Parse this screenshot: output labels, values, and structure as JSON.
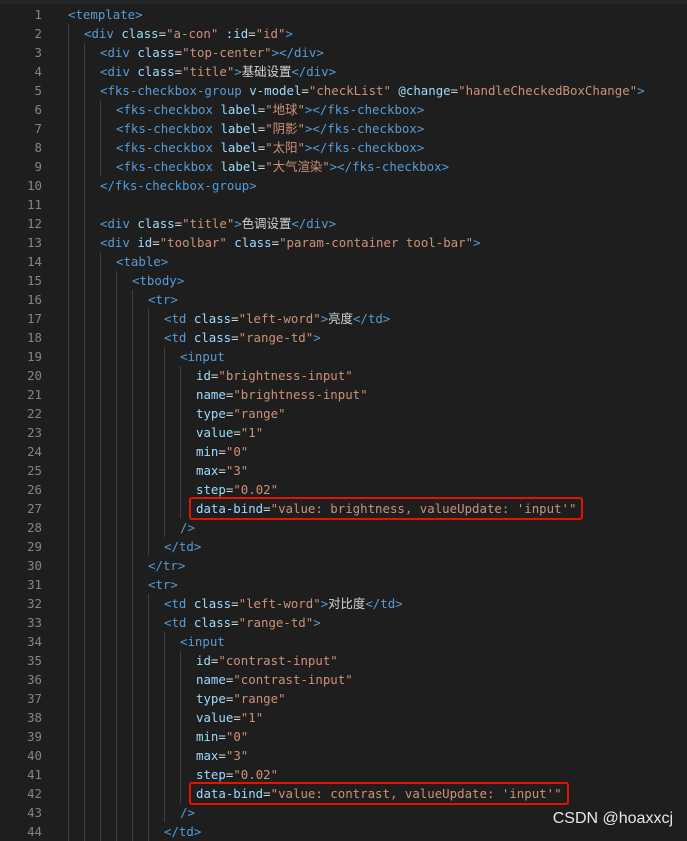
{
  "editor": {
    "lines": [
      {
        "n": "1",
        "indent": 0,
        "tokens": [
          {
            "c": "tag",
            "t": "<template>"
          }
        ]
      },
      {
        "n": "2",
        "indent": 1,
        "tokens": [
          {
            "c": "tag",
            "t": "<div "
          },
          {
            "c": "attr",
            "t": "class"
          },
          {
            "c": "txt",
            "t": "="
          },
          {
            "c": "str",
            "t": "\"a-con\""
          },
          {
            "c": "attr",
            "t": " :id"
          },
          {
            "c": "txt",
            "t": "="
          },
          {
            "c": "str",
            "t": "\"id\""
          },
          {
            "c": "tag",
            "t": ">"
          }
        ]
      },
      {
        "n": "3",
        "indent": 2,
        "tokens": [
          {
            "c": "tag",
            "t": "<div "
          },
          {
            "c": "attr",
            "t": "class"
          },
          {
            "c": "txt",
            "t": "="
          },
          {
            "c": "str",
            "t": "\"top-center\""
          },
          {
            "c": "tag",
            "t": "></div>"
          }
        ]
      },
      {
        "n": "4",
        "indent": 2,
        "tokens": [
          {
            "c": "tag",
            "t": "<div "
          },
          {
            "c": "attr",
            "t": "class"
          },
          {
            "c": "txt",
            "t": "="
          },
          {
            "c": "str",
            "t": "\"title\""
          },
          {
            "c": "tag",
            "t": ">"
          },
          {
            "c": "txt",
            "t": "基础设置"
          },
          {
            "c": "tag",
            "t": "</div>"
          }
        ]
      },
      {
        "n": "5",
        "indent": 2,
        "tokens": [
          {
            "c": "tag",
            "t": "<fks-checkbox-group "
          },
          {
            "c": "attr",
            "t": "v-model"
          },
          {
            "c": "txt",
            "t": "="
          },
          {
            "c": "str",
            "t": "\"checkList\""
          },
          {
            "c": "attr",
            "t": " @change"
          },
          {
            "c": "txt",
            "t": "="
          },
          {
            "c": "str",
            "t": "\"handleCheckedBoxChange\""
          },
          {
            "c": "tag",
            "t": ">"
          }
        ]
      },
      {
        "n": "6",
        "indent": 3,
        "tokens": [
          {
            "c": "tag",
            "t": "<fks-checkbox "
          },
          {
            "c": "attr",
            "t": "label"
          },
          {
            "c": "txt",
            "t": "="
          },
          {
            "c": "str",
            "t": "\"地球\""
          },
          {
            "c": "tag",
            "t": "></fks-checkbox>"
          }
        ]
      },
      {
        "n": "7",
        "indent": 3,
        "tokens": [
          {
            "c": "tag",
            "t": "<fks-checkbox "
          },
          {
            "c": "attr",
            "t": "label"
          },
          {
            "c": "txt",
            "t": "="
          },
          {
            "c": "str",
            "t": "\"阴影\""
          },
          {
            "c": "tag",
            "t": "></fks-checkbox>"
          }
        ]
      },
      {
        "n": "8",
        "indent": 3,
        "tokens": [
          {
            "c": "tag",
            "t": "<fks-checkbox "
          },
          {
            "c": "attr",
            "t": "label"
          },
          {
            "c": "txt",
            "t": "="
          },
          {
            "c": "str",
            "t": "\"太阳\""
          },
          {
            "c": "tag",
            "t": "></fks-checkbox>"
          }
        ]
      },
      {
        "n": "9",
        "indent": 3,
        "tokens": [
          {
            "c": "tag",
            "t": "<fks-checkbox "
          },
          {
            "c": "attr",
            "t": "label"
          },
          {
            "c": "txt",
            "t": "="
          },
          {
            "c": "str",
            "t": "\"大气渲染\""
          },
          {
            "c": "tag",
            "t": "></fks-checkbox>"
          }
        ]
      },
      {
        "n": "10",
        "indent": 2,
        "tokens": [
          {
            "c": "tag",
            "t": "</fks-checkbox-group>"
          }
        ]
      },
      {
        "n": "11",
        "indent": 2,
        "tokens": []
      },
      {
        "n": "12",
        "indent": 2,
        "tokens": [
          {
            "c": "tag",
            "t": "<div "
          },
          {
            "c": "attr",
            "t": "class"
          },
          {
            "c": "txt",
            "t": "="
          },
          {
            "c": "str",
            "t": "\"title\""
          },
          {
            "c": "tag",
            "t": ">"
          },
          {
            "c": "txt",
            "t": "色调设置"
          },
          {
            "c": "tag",
            "t": "</div>"
          }
        ]
      },
      {
        "n": "13",
        "indent": 2,
        "tokens": [
          {
            "c": "tag",
            "t": "<div "
          },
          {
            "c": "attr",
            "t": "id"
          },
          {
            "c": "txt",
            "t": "="
          },
          {
            "c": "str",
            "t": "\"toolbar\""
          },
          {
            "c": "attr",
            "t": " class"
          },
          {
            "c": "txt",
            "t": "="
          },
          {
            "c": "str",
            "t": "\"param-container tool-bar\""
          },
          {
            "c": "tag",
            "t": ">"
          }
        ]
      },
      {
        "n": "14",
        "indent": 3,
        "tokens": [
          {
            "c": "tag",
            "t": "<table>"
          }
        ]
      },
      {
        "n": "15",
        "indent": 4,
        "tokens": [
          {
            "c": "tag",
            "t": "<tbody>"
          }
        ]
      },
      {
        "n": "16",
        "indent": 5,
        "tokens": [
          {
            "c": "tag",
            "t": "<tr>"
          }
        ]
      },
      {
        "n": "17",
        "indent": 6,
        "tokens": [
          {
            "c": "tag",
            "t": "<td "
          },
          {
            "c": "attr",
            "t": "class"
          },
          {
            "c": "txt",
            "t": "="
          },
          {
            "c": "str",
            "t": "\"left-word\""
          },
          {
            "c": "tag",
            "t": ">"
          },
          {
            "c": "txt",
            "t": "亮度"
          },
          {
            "c": "tag",
            "t": "</td>"
          }
        ]
      },
      {
        "n": "18",
        "indent": 6,
        "tokens": [
          {
            "c": "tag",
            "t": "<td "
          },
          {
            "c": "attr",
            "t": "class"
          },
          {
            "c": "txt",
            "t": "="
          },
          {
            "c": "str",
            "t": "\"range-td\""
          },
          {
            "c": "tag",
            "t": ">"
          }
        ]
      },
      {
        "n": "19",
        "indent": 7,
        "tokens": [
          {
            "c": "tag",
            "t": "<input"
          }
        ]
      },
      {
        "n": "20",
        "indent": 8,
        "tokens": [
          {
            "c": "attr",
            "t": "id"
          },
          {
            "c": "txt",
            "t": "="
          },
          {
            "c": "str",
            "t": "\"brightness-input\""
          }
        ]
      },
      {
        "n": "21",
        "indent": 8,
        "tokens": [
          {
            "c": "attr",
            "t": "name"
          },
          {
            "c": "txt",
            "t": "="
          },
          {
            "c": "str",
            "t": "\"brightness-input\""
          }
        ]
      },
      {
        "n": "22",
        "indent": 8,
        "tokens": [
          {
            "c": "attr",
            "t": "type"
          },
          {
            "c": "txt",
            "t": "="
          },
          {
            "c": "str",
            "t": "\"range\""
          }
        ]
      },
      {
        "n": "23",
        "indent": 8,
        "tokens": [
          {
            "c": "attr",
            "t": "value"
          },
          {
            "c": "txt",
            "t": "="
          },
          {
            "c": "str",
            "t": "\"1\""
          }
        ]
      },
      {
        "n": "24",
        "indent": 8,
        "tokens": [
          {
            "c": "attr",
            "t": "min"
          },
          {
            "c": "txt",
            "t": "="
          },
          {
            "c": "str",
            "t": "\"0\""
          }
        ]
      },
      {
        "n": "25",
        "indent": 8,
        "tokens": [
          {
            "c": "attr",
            "t": "max"
          },
          {
            "c": "txt",
            "t": "="
          },
          {
            "c": "str",
            "t": "\"3\""
          }
        ]
      },
      {
        "n": "26",
        "indent": 8,
        "tokens": [
          {
            "c": "attr",
            "t": "step"
          },
          {
            "c": "txt",
            "t": "="
          },
          {
            "c": "str",
            "t": "\"0.02\""
          }
        ]
      },
      {
        "n": "27",
        "indent": 8,
        "tokens": [
          {
            "c": "attr",
            "t": "data-bind"
          },
          {
            "c": "txt",
            "t": "="
          },
          {
            "c": "str",
            "t": "\"value: brightness, valueUpdate: 'input'\""
          }
        ]
      },
      {
        "n": "28",
        "indent": 7,
        "tokens": [
          {
            "c": "tag",
            "t": "/>"
          }
        ]
      },
      {
        "n": "29",
        "indent": 6,
        "tokens": [
          {
            "c": "tag",
            "t": "</td>"
          }
        ]
      },
      {
        "n": "30",
        "indent": 5,
        "tokens": [
          {
            "c": "tag",
            "t": "</tr>"
          }
        ]
      },
      {
        "n": "31",
        "indent": 5,
        "tokens": [
          {
            "c": "tag",
            "t": "<tr>"
          }
        ]
      },
      {
        "n": "32",
        "indent": 6,
        "tokens": [
          {
            "c": "tag",
            "t": "<td "
          },
          {
            "c": "attr",
            "t": "class"
          },
          {
            "c": "txt",
            "t": "="
          },
          {
            "c": "str",
            "t": "\"left-word\""
          },
          {
            "c": "tag",
            "t": ">"
          },
          {
            "c": "txt",
            "t": "对比度"
          },
          {
            "c": "tag",
            "t": "</td>"
          }
        ]
      },
      {
        "n": "33",
        "indent": 6,
        "tokens": [
          {
            "c": "tag",
            "t": "<td "
          },
          {
            "c": "attr",
            "t": "class"
          },
          {
            "c": "txt",
            "t": "="
          },
          {
            "c": "str",
            "t": "\"range-td\""
          },
          {
            "c": "tag",
            "t": ">"
          }
        ]
      },
      {
        "n": "34",
        "indent": 7,
        "tokens": [
          {
            "c": "tag",
            "t": "<input"
          }
        ]
      },
      {
        "n": "35",
        "indent": 8,
        "tokens": [
          {
            "c": "attr",
            "t": "id"
          },
          {
            "c": "txt",
            "t": "="
          },
          {
            "c": "str",
            "t": "\"contrast-input\""
          }
        ]
      },
      {
        "n": "36",
        "indent": 8,
        "tokens": [
          {
            "c": "attr",
            "t": "name"
          },
          {
            "c": "txt",
            "t": "="
          },
          {
            "c": "str",
            "t": "\"contrast-input\""
          }
        ]
      },
      {
        "n": "37",
        "indent": 8,
        "tokens": [
          {
            "c": "attr",
            "t": "type"
          },
          {
            "c": "txt",
            "t": "="
          },
          {
            "c": "str",
            "t": "\"range\""
          }
        ]
      },
      {
        "n": "38",
        "indent": 8,
        "tokens": [
          {
            "c": "attr",
            "t": "value"
          },
          {
            "c": "txt",
            "t": "="
          },
          {
            "c": "str",
            "t": "\"1\""
          }
        ]
      },
      {
        "n": "39",
        "indent": 8,
        "tokens": [
          {
            "c": "attr",
            "t": "min"
          },
          {
            "c": "txt",
            "t": "="
          },
          {
            "c": "str",
            "t": "\"0\""
          }
        ]
      },
      {
        "n": "40",
        "indent": 8,
        "tokens": [
          {
            "c": "attr",
            "t": "max"
          },
          {
            "c": "txt",
            "t": "="
          },
          {
            "c": "str",
            "t": "\"3\""
          }
        ]
      },
      {
        "n": "41",
        "indent": 8,
        "tokens": [
          {
            "c": "attr",
            "t": "step"
          },
          {
            "c": "txt",
            "t": "="
          },
          {
            "c": "str",
            "t": "\"0.02\""
          }
        ]
      },
      {
        "n": "42",
        "indent": 8,
        "tokens": [
          {
            "c": "attr",
            "t": "data-bind"
          },
          {
            "c": "txt",
            "t": "="
          },
          {
            "c": "str",
            "t": "\"value: contrast, valueUpdate: 'input'\""
          }
        ]
      },
      {
        "n": "43",
        "indent": 7,
        "tokens": [
          {
            "c": "tag",
            "t": "/>"
          }
        ]
      },
      {
        "n": "44",
        "indent": 6,
        "tokens": [
          {
            "c": "tag",
            "t": "</td>"
          }
        ]
      }
    ],
    "highlighted_lines": [
      "27",
      "42"
    ],
    "colors": {
      "background": "#1e1e1e",
      "tag": "#569cd6",
      "attribute": "#9cdcfe",
      "string": "#ce9178",
      "text": "#d4d4d4",
      "line_number": "#858585",
      "highlight_border": "#e51400"
    }
  },
  "watermark": "CSDN @hoaxxcj"
}
